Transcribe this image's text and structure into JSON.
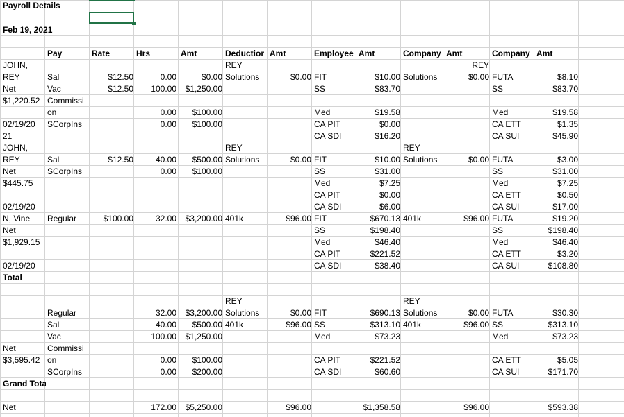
{
  "sheet": {
    "title": "Payroll Details",
    "date": "Feb 19, 2021",
    "header": {
      "pay": "Pay",
      "rate": "Rate",
      "hrs": "Hrs",
      "amt1": "Amt",
      "deduction": "Deductior",
      "amt2": "Amt",
      "employee": "Employee",
      "amt3": "Amt",
      "company1": "Company",
      "amt4": "Amt",
      "company2": "Company",
      "amt5": "Amt"
    },
    "rows": [
      {
        "r": 5,
        "A": "JOHN,",
        "F": "REY",
        "K": "REY"
      },
      {
        "r": 6,
        "A": "REY",
        "B": "Sal",
        "C": "$12.50",
        "D": "0.00",
        "E": "$0.00",
        "F": "Solutions",
        "G": "$0.00",
        "H": "FIT",
        "I": "$10.00",
        "J": "Solutions",
        "K": "$0.00",
        "L": "FUTA",
        "M": "$8.10"
      },
      {
        "r": 7,
        "A": "Net",
        "B": "Vac",
        "C": "$12.50",
        "D": "100.00",
        "E": "$1,250.00",
        "H": "SS",
        "I": "$83.70",
        "L": "SS",
        "M": "$83.70"
      },
      {
        "r": 8,
        "A": "$1,220.52",
        "B": "Commissi"
      },
      {
        "r": 9,
        "B": "on",
        "D": "0.00",
        "E": "$100.00",
        "H": "Med",
        "I": "$19.58",
        "L": "Med",
        "M": "$19.58"
      },
      {
        "r": 10,
        "A": "02/19/20",
        "B": "SCorpIns",
        "D": "0.00",
        "E": "$100.00",
        "H": "CA PIT",
        "I": "$0.00",
        "L": "CA ETT",
        "M": "$1.35"
      },
      {
        "r": 11,
        "A": "21",
        "H": "CA SDI",
        "I": "$16.20",
        "L": "CA SUI",
        "M": "$45.90"
      },
      {
        "r": 12,
        "A": "JOHN,",
        "F": "REY",
        "J": "REY"
      },
      {
        "r": 13,
        "A": "REY",
        "B": "Sal",
        "C": "$12.50",
        "D": "40.00",
        "E": "$500.00",
        "F": "Solutions",
        "G": "$0.00",
        "H": "FIT",
        "I": "$10.00",
        "J": "Solutions",
        "K": "$0.00",
        "L": "FUTA",
        "M": "$3.00"
      },
      {
        "r": 14,
        "A": "Net",
        "B": "SCorpIns",
        "D": "0.00",
        "E": "$100.00",
        "H": "SS",
        "I": "$31.00",
        "L": "SS",
        "M": "$31.00"
      },
      {
        "r": 15,
        "A": "$445.75",
        "H": "Med",
        "I": "$7.25",
        "L": "Med",
        "M": "$7.25"
      },
      {
        "r": 16,
        "H": "CA PIT",
        "I": "$0.00",
        "L": "CA ETT",
        "M": "$0.50"
      },
      {
        "r": 17,
        "A": "02/19/20",
        "H": "CA SDI",
        "I": "$6.00",
        "L": "CA SUI",
        "M": "$17.00"
      },
      {
        "r": 18,
        "A": "N, Vine",
        "B": "Regular",
        "C": "$100.00",
        "D": "32.00",
        "E": "$3,200.00",
        "F": "401k",
        "G": "$96.00",
        "H": "FIT",
        "I": "$670.13",
        "J": "401k",
        "K": "$96.00",
        "L": "FUTA",
        "M": "$19.20"
      },
      {
        "r": 19,
        "A": "Net",
        "H": "SS",
        "I": "$198.40",
        "L": "SS",
        "M": "$198.40"
      },
      {
        "r": 20,
        "A": "$1,929.15",
        "H": "Med",
        "I": "$46.40",
        "L": "Med",
        "M": "$46.40"
      },
      {
        "r": 21,
        "H": "CA PIT",
        "I": "$221.52",
        "L": "CA ETT",
        "M": "$3.20"
      },
      {
        "r": 22,
        "A": "02/19/20",
        "H": "CA SDI",
        "I": "$38.40",
        "L": "CA SUI",
        "M": "$108.80"
      },
      {
        "r": 23,
        "A": "Total"
      },
      {
        "r": 25,
        "F": "REY",
        "J": "REY"
      },
      {
        "r": 26,
        "B": "Regular",
        "D": "32.00",
        "E": "$3,200.00",
        "F": "Solutions",
        "G": "$0.00",
        "H": "FIT",
        "I": "$690.13",
        "J": "Solutions",
        "K": "$0.00",
        "L": "FUTA",
        "M": "$30.30"
      },
      {
        "r": 27,
        "B": "Sal",
        "D": "40.00",
        "E": "$500.00",
        "F": "401k",
        "G": "$96.00",
        "H": "SS",
        "I": "$313.10",
        "J": "401k",
        "K": "$96.00",
        "L": "SS",
        "M": "$313.10"
      },
      {
        "r": 28,
        "B": "Vac",
        "D": "100.00",
        "E": "$1,250.00",
        "H": "Med",
        "I": "$73.23",
        "L": "Med",
        "M": "$73.23"
      },
      {
        "r": 29,
        "A": "Net",
        "B": "Commissi"
      },
      {
        "r": 30,
        "A": "$3,595.42",
        "B": "on",
        "D": "0.00",
        "E": "$100.00",
        "H": "CA PIT",
        "I": "$221.52",
        "L": "CA ETT",
        "M": "$5.05"
      },
      {
        "r": 31,
        "B": "SCorpIns",
        "D": "0.00",
        "E": "$200.00",
        "H": "CA SDI",
        "I": "$60.60",
        "L": "CA SUI",
        "M": "$171.70"
      },
      {
        "r": 32,
        "A": "Grand Total"
      },
      {
        "r": 34,
        "A": "Net",
        "D": "172.00",
        "E": "$5,250.00",
        "G": "$96.00",
        "I": "$1,358.58",
        "K": "$96.00",
        "M": "$593.38"
      }
    ]
  }
}
